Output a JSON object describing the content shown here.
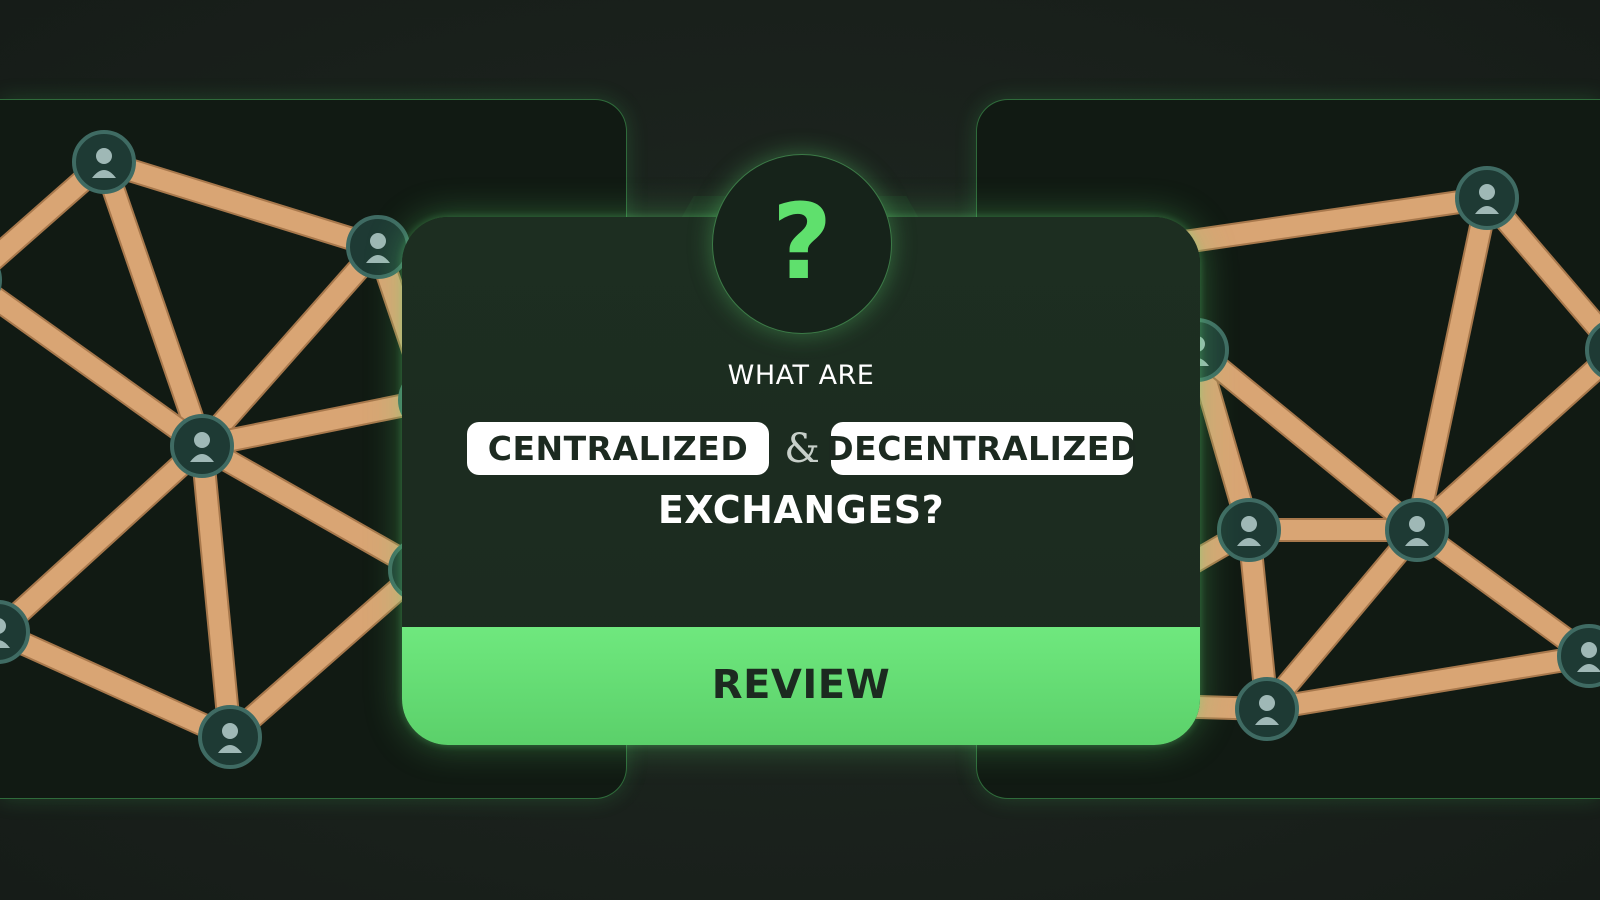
{
  "question_icon": "?",
  "intro": "WHAT ARE",
  "term_a": "CENTRALIZED",
  "ampersand": "&",
  "term_b": "DECENTRALIZED",
  "headline": "EXCHANGES?",
  "button_label": "REVIEW",
  "colors": {
    "accent_green": "#6ee87d",
    "card_bg": "#1d2e21",
    "page_bg": "#1a211c",
    "stick": "#d9a574",
    "pill_bg": "#ffffff",
    "pill_text": "#1c2a20"
  },
  "icons": [
    "question-mark-icon",
    "user-token-icon"
  ]
}
